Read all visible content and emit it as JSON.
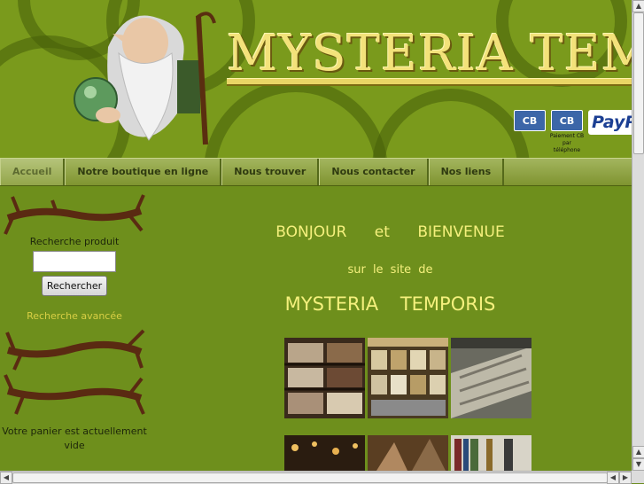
{
  "header": {
    "site_title": "MYSTERIA TEMP",
    "payment_note": "Paiement CB par téléphone",
    "cb_label": "CB",
    "paypal_label": "PayP"
  },
  "nav": {
    "items": [
      {
        "label": "Accueil",
        "active": true
      },
      {
        "label": "Notre boutique en ligne"
      },
      {
        "label": "Nous trouver"
      },
      {
        "label": "Nous contacter"
      },
      {
        "label": "Nos liens"
      }
    ]
  },
  "sidebar": {
    "search_label": "Recherche produit",
    "search_value": "",
    "search_button": "Rechercher",
    "advanced_link": "Recherche avancée",
    "cart_text": "Votre panier est actuellement vide"
  },
  "main": {
    "greeting_1": "BONJOUR",
    "greeting_2": "et",
    "greeting_3": "BIENVENUE",
    "subtitle": "sur le site de",
    "shop_name": "MYSTERIA TEMPORIS"
  },
  "colors": {
    "background": "#6e8f1c",
    "heading": "#f5f07d",
    "link": "#d8cf44"
  }
}
